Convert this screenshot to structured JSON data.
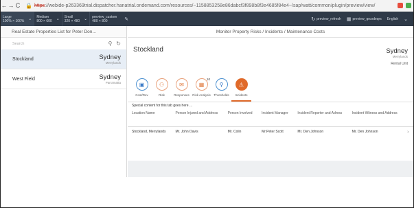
{
  "browser": {
    "back": "←",
    "forward": "→",
    "reload": "C",
    "url_scheme": "https",
    "url_rest": "://webide-p263369trial.dispatcher.hanatrial.ondemand.com/resources/~1158853258e86dabcf3f898b8f3e4685f84e4~/sap/watt/common/plugin/preview/view/"
  },
  "toolbar": {
    "viewports": [
      {
        "line1": "Large",
        "line2": "100% × 100%"
      },
      {
        "line1": "Medium",
        "line2": "800 × 600"
      },
      {
        "line1": "Small",
        "line2": "320 × 480"
      },
      {
        "line1": "preview_custom",
        "line2": "480 × 800"
      }
    ],
    "refresh_label": "preview_refresh",
    "qr_label": "preview_qrcodeqrs",
    "language": "English"
  },
  "master": {
    "title": "Real Estate Properties List for Peter Don...",
    "search_placeholder": "Search",
    "items": [
      {
        "name": "Stockland",
        "city": "Sydney",
        "suburb": "Merrylands"
      },
      {
        "name": "West Field",
        "city": "Sydney",
        "suburb": "Parramatta"
      }
    ]
  },
  "detail": {
    "title": "Monitor Property Risks / Incidents / Maintenance Costs",
    "object": {
      "name": "Stockland",
      "city": "Sydney",
      "suburb": "Merrylands",
      "status": "Rental Unit"
    },
    "tabs": [
      {
        "label": "Cost/Rev",
        "icon": "money-icon",
        "glyph": "▣"
      },
      {
        "label": "Risk",
        "icon": "risk-icon",
        "glyph": "⚇"
      },
      {
        "label": "Responses",
        "icon": "responses-icon",
        "glyph": "✉"
      },
      {
        "label": "Risk Analysis",
        "icon": "analysis-icon",
        "glyph": "▦",
        "count": "10"
      },
      {
        "label": "Thresholds",
        "icon": "thresholds-icon",
        "glyph": "⚲"
      },
      {
        "label": "Incidents",
        "icon": "incident-icon",
        "glyph": "⚠"
      }
    ],
    "special_content": "Special content for this tab goes here ...",
    "table": {
      "headers": [
        "Location Name",
        "Person Injured and Address",
        "Person Involved",
        "Incident Manager",
        "Incident Reporter and Adress",
        "Incident Witness and Address"
      ],
      "rows": [
        [
          "Stockland, Merrylands",
          "Mr. John Davis",
          "Mr. Colin",
          "Mr.Peter Scott",
          "Mr. Den Johnson",
          "Mr. Den Johnson"
        ]
      ]
    }
  },
  "colors": {
    "toolbar": "#2f3a48",
    "accent": "#e06a2a",
    "blue": "#3a7bc8"
  }
}
